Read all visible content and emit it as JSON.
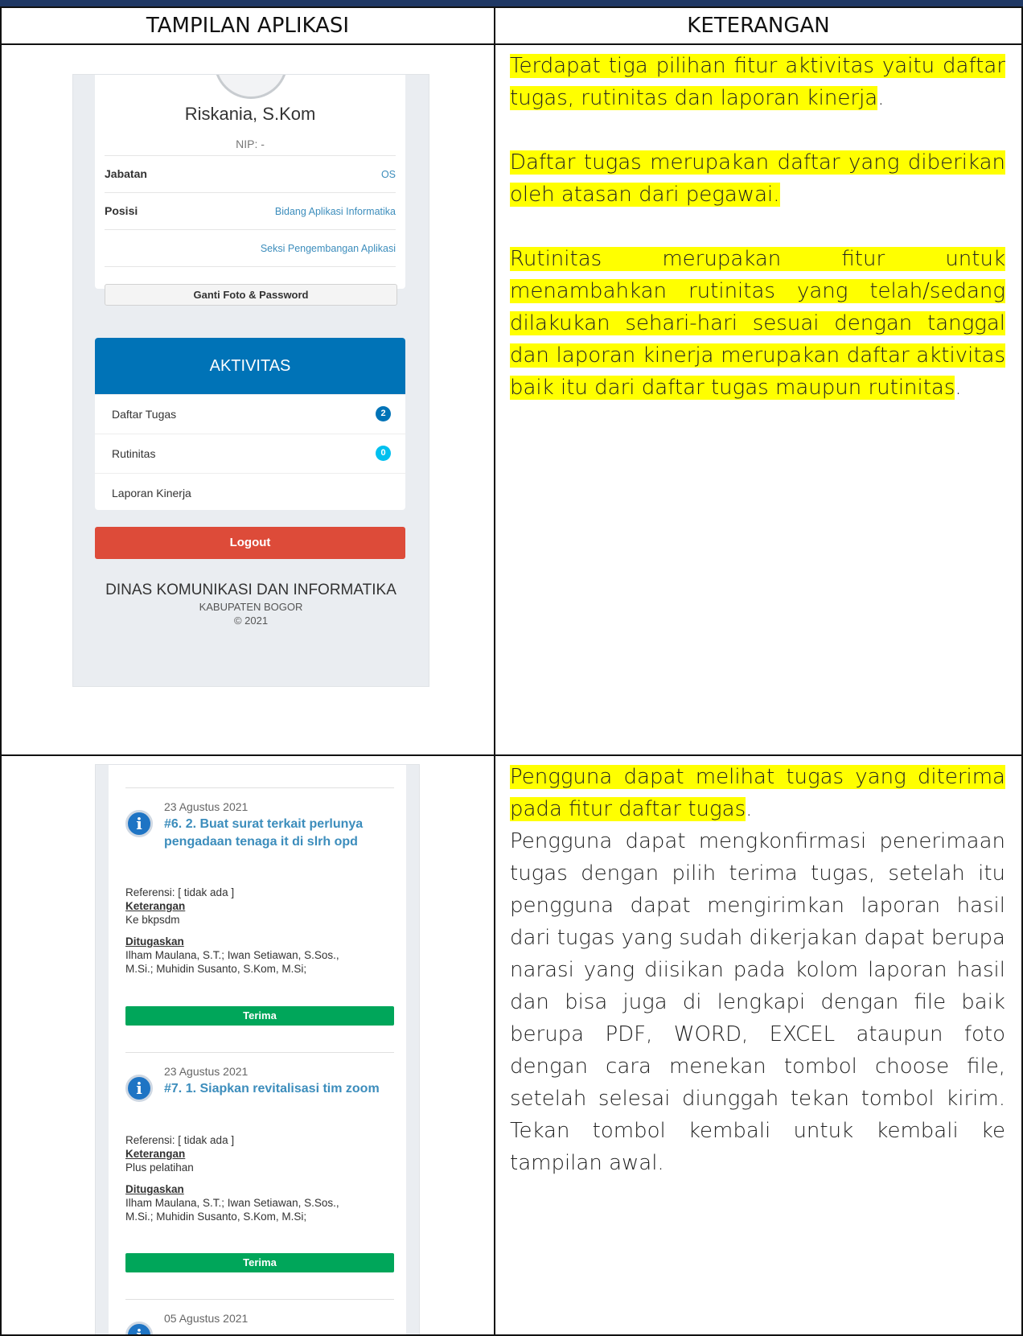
{
  "header": {
    "col1": "TAMPILAN APLIKASI",
    "col2": "KETERANGAN"
  },
  "row1": {
    "phone": {
      "name": "Riskania, S.Kom",
      "nip": "NIP: -",
      "jabatan_label": "Jabatan",
      "jabatan_value": "OS",
      "posisi_label": "Posisi",
      "posisi_value": "Bidang Aplikasi Informatika",
      "posisi_value2": "Seksi Pengembangan Aplikasi",
      "ganti_button": "Ganti Foto & Password",
      "aktivitas_title": "AKTIVITAS",
      "menu": [
        {
          "label": "Daftar Tugas",
          "badge": "2",
          "badge_color": "#0073b7"
        },
        {
          "label": "Rutinitas",
          "badge": "0",
          "badge_color": "#00c0ef"
        },
        {
          "label": "Laporan Kinerja"
        }
      ],
      "logout_button": "Logout",
      "footer_line1": "DINAS KOMUNIKASI DAN INFORMATIKA",
      "footer_line2": "KABUPATEN BOGOR",
      "footer_line3": "© 2021"
    },
    "desc": {
      "p1": "Terdapat tiga pilihan fitur aktivitas yaitu  daftar tugas, rutinitas dan laporan kinerja",
      "p1_end": ".",
      "p2": "Daftar tugas merupakan daftar yang diberikan oleh atasan dari pegawai.",
      "p3": "Rutinitas merupakan fitur untuk menambahkan rutinitas yang telah/sedang dilakukan sehari-hari sesuai dengan tanggal dan laporan kinerja merupakan daftar aktivitas baik itu dari daftar tugas maupun rutinitas",
      "p3_end": "."
    }
  },
  "row2": {
    "phone": {
      "tasks": [
        {
          "date": "23 Agustus 2021",
          "title": "#6. 2. Buat surat terkait perlunya pengadaan tenaga it di slrh opd",
          "referensi": "Referensi: [ tidak ada ]",
          "keterangan_label": "Keterangan",
          "keterangan": "Ke bkpsdm",
          "ditugaskan_label": "Ditugaskan",
          "ditugaskan": "Ilham Maulana, S.T.; Iwan Setiawan, S.Sos., M.Si.; Muhidin Susanto, S.Kom, M.Si;",
          "button": "Terima"
        },
        {
          "date": "23 Agustus 2021",
          "title": "#7. 1. Siapkan revitalisasi tim zoom",
          "referensi": "Referensi: [ tidak ada ]",
          "keterangan_label": "Keterangan",
          "keterangan": "Plus pelatihan",
          "ditugaskan_label": "Ditugaskan",
          "ditugaskan": "Ilham Maulana, S.T.; Iwan Setiawan, S.Sos., M.Si.; Muhidin Susanto, S.Kom, M.Si;",
          "button": "Terima"
        },
        {
          "date": "05 Agustus 2021"
        }
      ]
    },
    "desc": {
      "p1": "Pengguna dapat melihat tugas yang diterima pada fitur daftar tugas",
      "p1_end": ".",
      "p2": "Pengguna dapat mengkonfirmasi penerimaan tugas dengan pilih terima tugas, setelah itu pengguna dapat mengirimkan laporan hasil dari tugas yang sudah dikerjakan dapat berupa narasi yang diisikan pada kolom laporan hasil dan bisa juga di lengkapi dengan file baik berupa PDF, WORD, EXCEL ataupun foto dengan cara menekan tombol choose file, setelah selesai diunggah tekan tombol kirim. Tekan tombol kembali untuk kembali ke tampilan awal."
    }
  },
  "colors": {
    "highlight": "#ffff00",
    "header_bar": "#1f3864",
    "aktivitas": "#0073b7",
    "logout": "#dd4b39",
    "terima": "#00a65a",
    "link": "#3c8dbc"
  }
}
